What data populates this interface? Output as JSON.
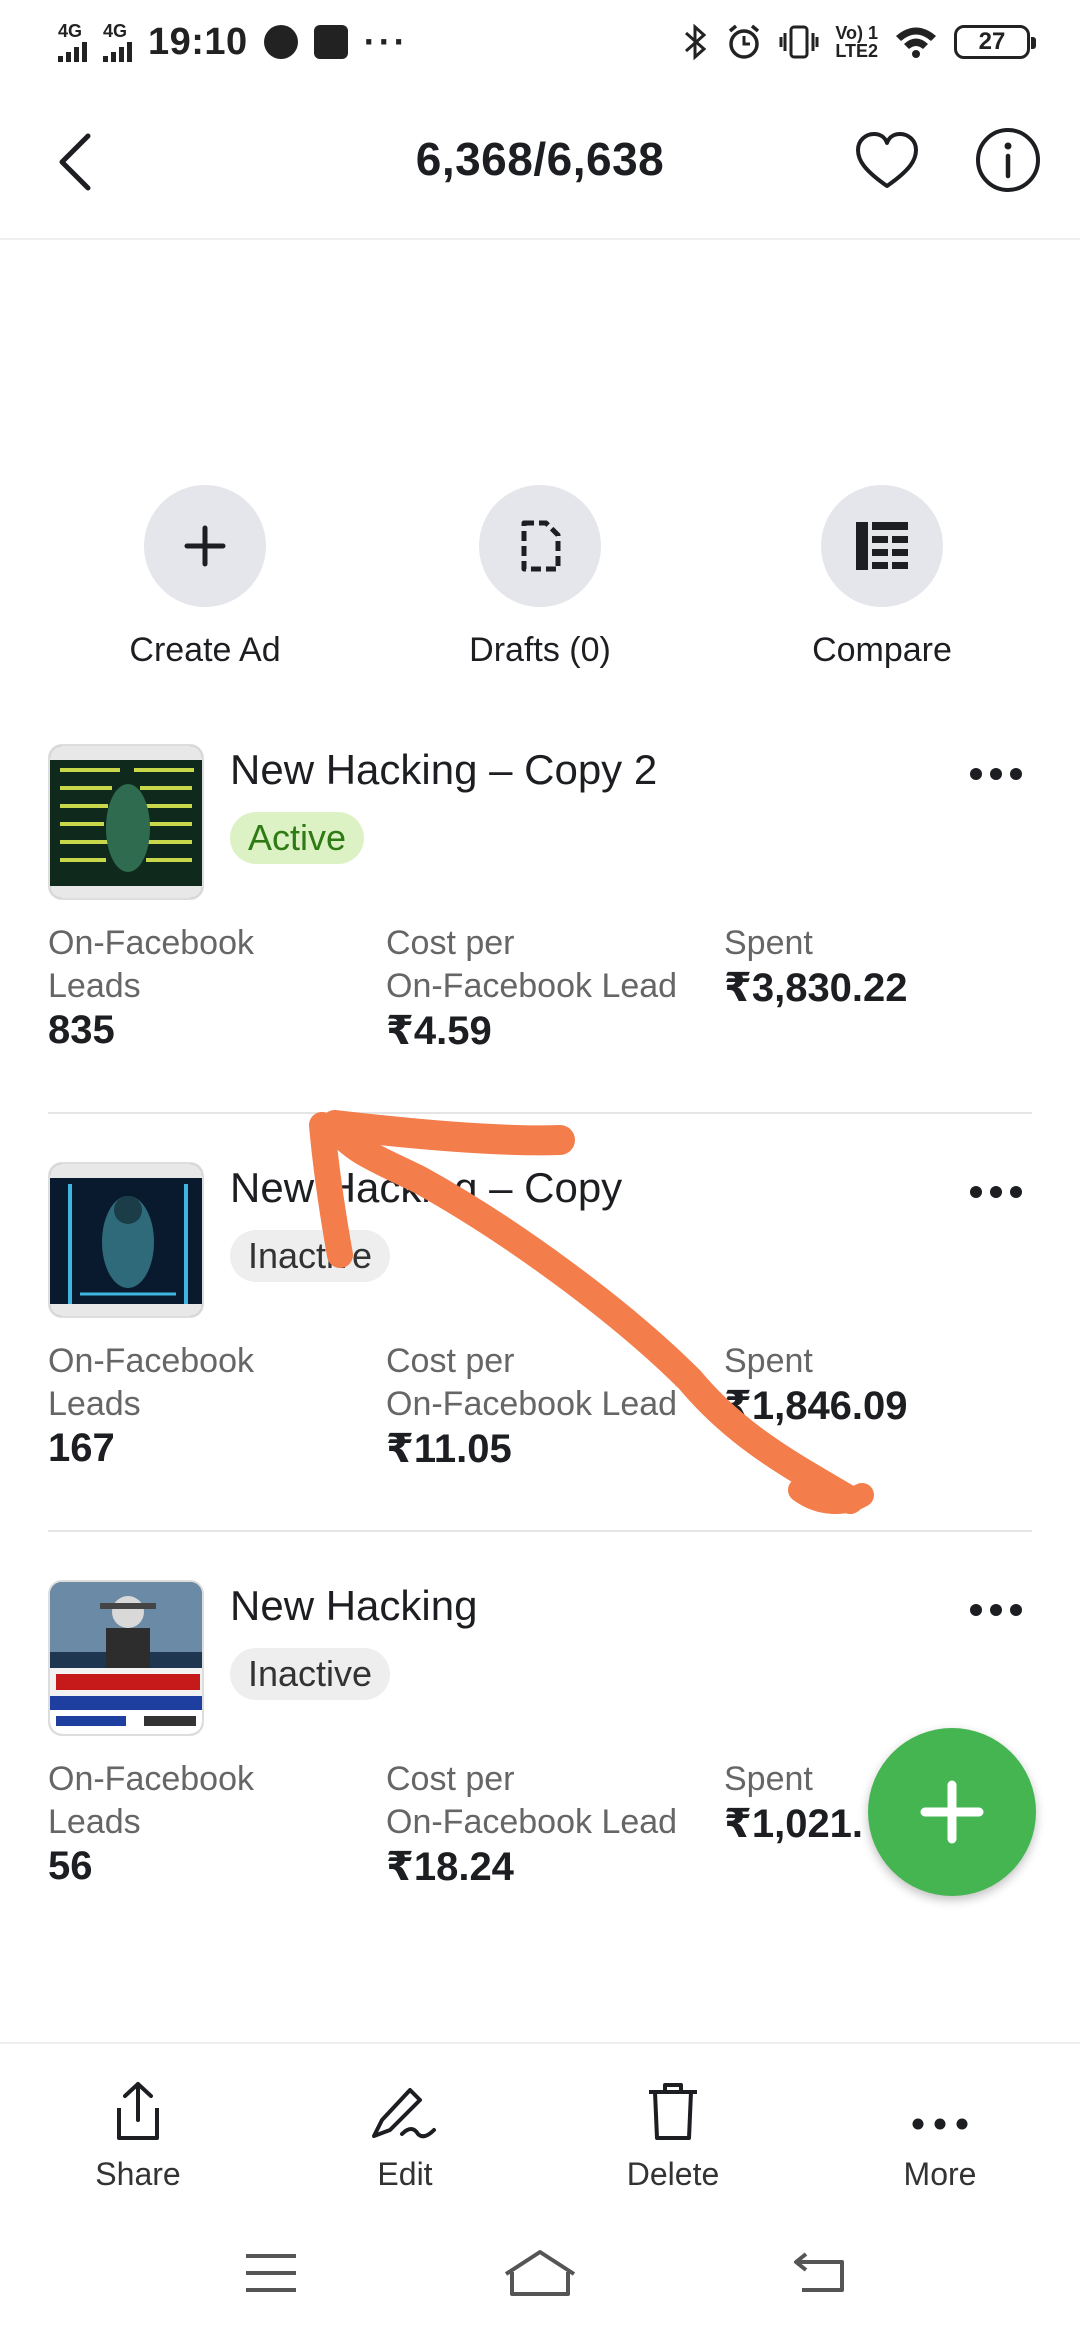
{
  "status_bar": {
    "net1": "4G",
    "net2": "4G",
    "time": "19:10",
    "more": "···",
    "lte_top": "Vo) 1",
    "lte_bottom": "LTE2",
    "battery": "27"
  },
  "header": {
    "title": "6,368/6,638"
  },
  "quick_actions": [
    {
      "label": "Create Ad",
      "icon": "plus-icon"
    },
    {
      "label": "Drafts (0)",
      "icon": "document-icon"
    },
    {
      "label": "Compare",
      "icon": "compare-list-icon"
    }
  ],
  "campaigns": [
    {
      "name": "New Hacking – Copy 2",
      "status": "Active",
      "metrics": [
        {
          "label_line1": "On-Facebook",
          "label_line2": "Leads",
          "value": "835"
        },
        {
          "label_line1": "Cost per",
          "label_line2": "On-Facebook Lead",
          "value": "₹4.59"
        },
        {
          "label_line1": "Spent",
          "label_line2": "",
          "value": "₹3,830.22"
        }
      ]
    },
    {
      "name": "New Hacking – Copy",
      "status": "Inactive",
      "metrics": [
        {
          "label_line1": "On-Facebook",
          "label_line2": "Leads",
          "value": "167"
        },
        {
          "label_line1": "Cost per",
          "label_line2": "On-Facebook Lead",
          "value": "₹11.05"
        },
        {
          "label_line1": "Spent",
          "label_line2": "",
          "value": "₹1,846.09"
        }
      ]
    },
    {
      "name": "New Hacking",
      "status": "Inactive",
      "metrics": [
        {
          "label_line1": "On-Facebook",
          "label_line2": "Leads",
          "value": "56"
        },
        {
          "label_line1": "Cost per",
          "label_line2": "On-Facebook Lead",
          "value": "₹18.24"
        },
        {
          "label_line1": "Spent",
          "label_line2": "",
          "value": "₹1,021."
        }
      ]
    }
  ],
  "toolbar": [
    {
      "label": "Share",
      "icon": "share-icon"
    },
    {
      "label": "Edit",
      "icon": "edit-pen-icon"
    },
    {
      "label": "Delete",
      "icon": "trash-icon"
    },
    {
      "label": "More",
      "icon": "more-dots-icon"
    }
  ],
  "colors": {
    "accent_green": "#45b552",
    "active_badge_bg": "#dcf2c4",
    "active_badge_text": "#2e7a15",
    "annotation_orange": "#f37d4b"
  }
}
